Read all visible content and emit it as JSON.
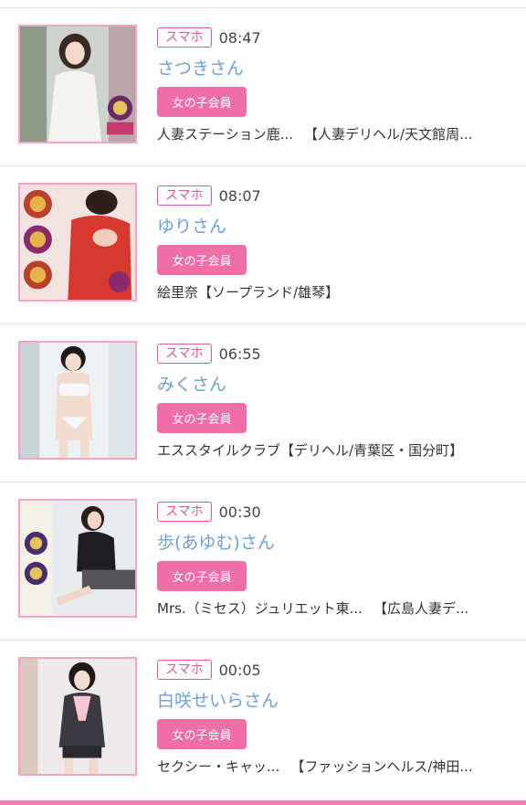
{
  "items": [
    {
      "device": "スマホ",
      "time": "08:47",
      "name": "さつきさん",
      "member_label": "女の子会員",
      "shop": "人妻ステーション鹿...",
      "category": "【人妻デリヘル/天文館周..."
    },
    {
      "device": "スマホ",
      "time": "08:07",
      "name": "ゆりさん",
      "member_label": "女の子会員",
      "shop": "絵里奈",
      "category": "【ソープランド/雄琴】"
    },
    {
      "device": "スマホ",
      "time": "06:55",
      "name": "みくさん",
      "member_label": "女の子会員",
      "shop": "エススタイルクラブ",
      "category": "【デリヘル/青葉区・国分町】"
    },
    {
      "device": "スマホ",
      "time": "00:30",
      "name": "歩(あゆむ)さん",
      "member_label": "女の子会員",
      "shop": "Mrs.（ミセス）ジュリエット東...",
      "category": "【広島人妻デ..."
    },
    {
      "device": "スマホ",
      "time": "00:05",
      "name": "白咲せいらさん",
      "member_label": "女の子会員",
      "shop": "セクシー・キャッ...",
      "category": "【ファッションヘルス/神田..."
    }
  ],
  "colors": {
    "accent_pink": "#f06ea8",
    "badge_outline": "#d85a97",
    "name_blue": "#6f9fd3",
    "thumb_border": "#f2a4c4"
  },
  "icons": [
    "profile-photo"
  ]
}
